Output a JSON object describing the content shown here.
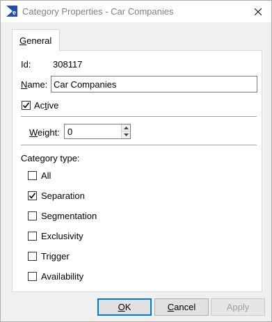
{
  "window": {
    "title": "Category Properties - Car Companies"
  },
  "tabs": [
    {
      "label_underlined": "G",
      "label_rest": "eneral"
    }
  ],
  "general": {
    "id_label": "Id:",
    "id_value": "308117",
    "name_label_u": "N",
    "name_label_rest": "ame:",
    "name_value": "Car Companies",
    "active_label_pre": "Ac",
    "active_label_u": "t",
    "active_label_rest": "ive",
    "active_checked": true,
    "weight_label_u": "W",
    "weight_label_rest": "eight:",
    "weight_value": "0",
    "category_type_label": "Category type:",
    "category_types": [
      {
        "label": "All",
        "checked": false
      },
      {
        "label": "Separation",
        "checked": true
      },
      {
        "label": "Segmentation",
        "checked": false
      },
      {
        "label": "Exclusivity",
        "checked": false
      },
      {
        "label": "Trigger",
        "checked": false
      },
      {
        "label": "Availability",
        "checked": false
      }
    ]
  },
  "buttons": {
    "ok_u": "O",
    "ok_rest": "K",
    "cancel_u": "C",
    "cancel_rest": "ancel",
    "apply_label": "Apply"
  },
  "colors": {
    "accent": "#0078d7",
    "title_text": "#808080",
    "disabled_text": "#a0a0a0"
  }
}
